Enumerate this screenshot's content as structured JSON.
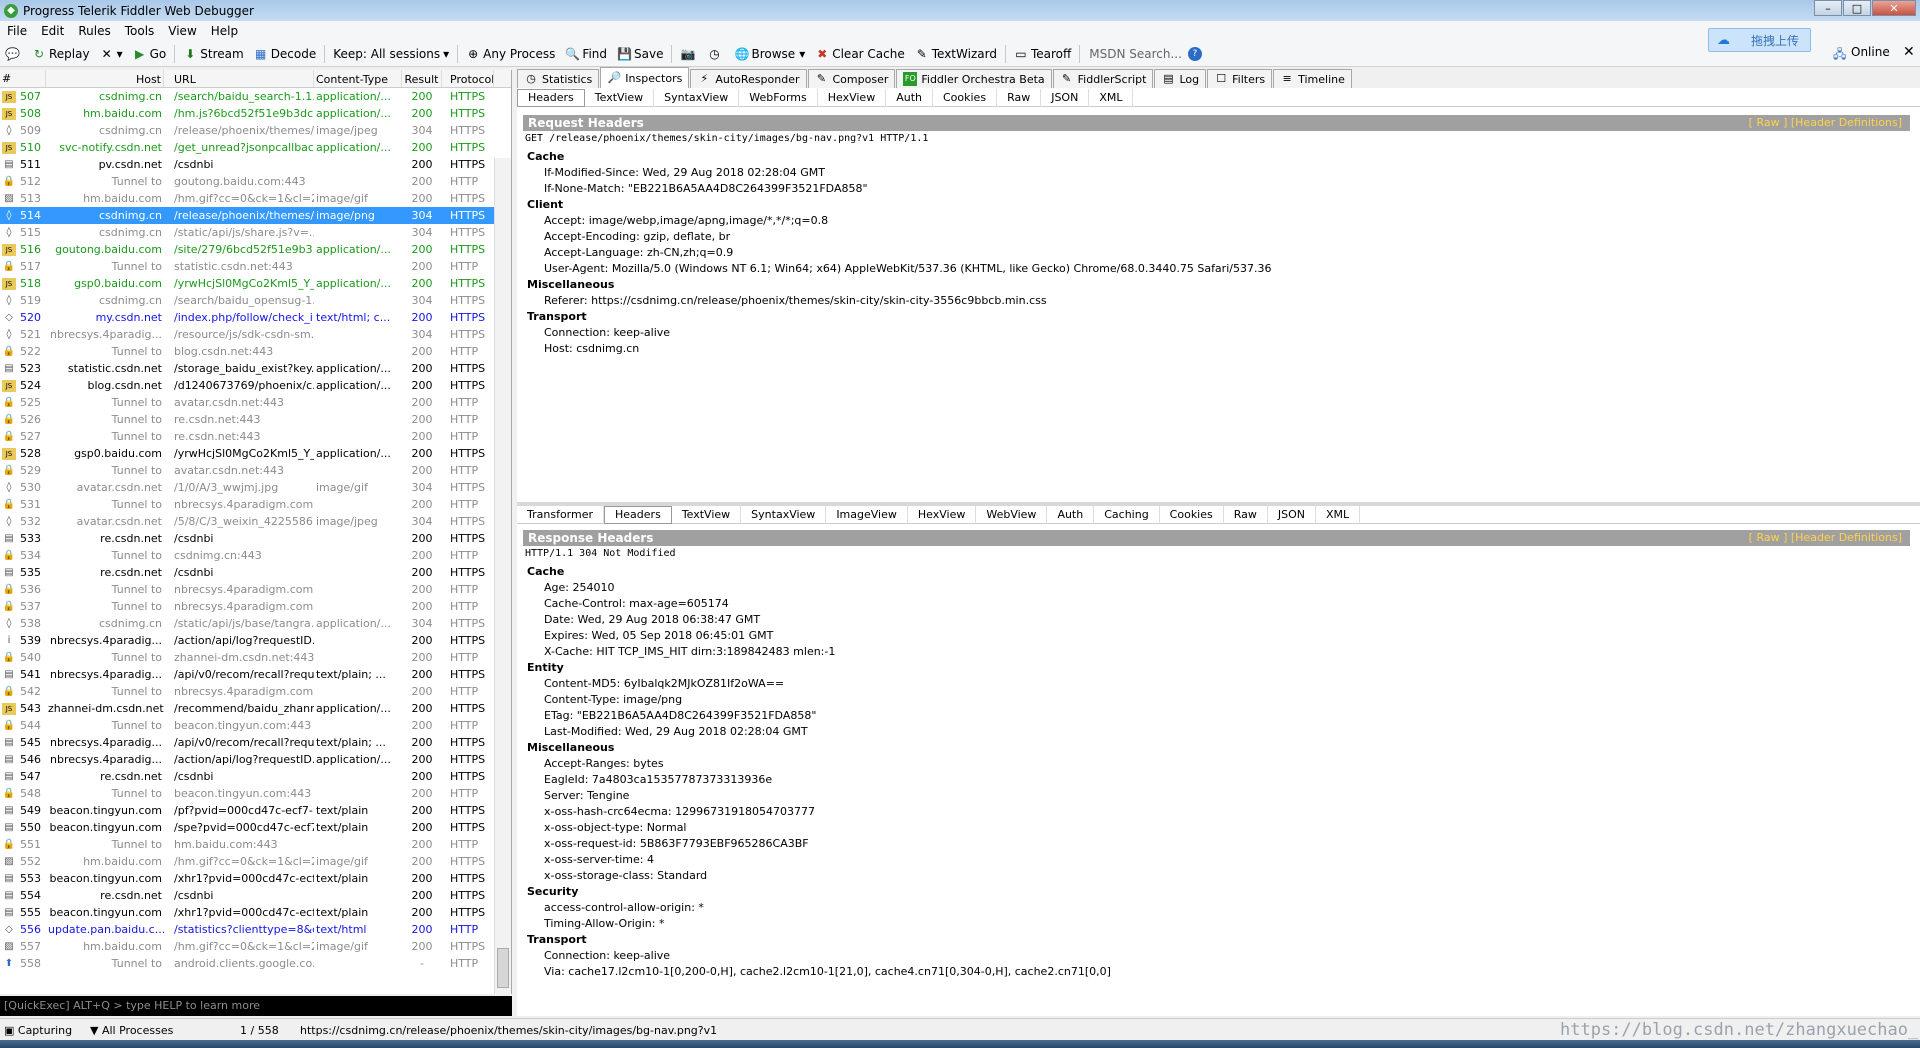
{
  "window": {
    "title": "Progress Telerik Fiddler Web Debugger",
    "icon": "fiddler-icon"
  },
  "menu": [
    "File",
    "Edit",
    "Rules",
    "Tools",
    "View",
    "Help"
  ],
  "toolbar": {
    "replay": "Replay",
    "go": "Go",
    "stream": "Stream",
    "decode": "Decode",
    "keep": "Keep: All sessions",
    "any_process": "Any Process",
    "find": "Find",
    "save": "Save",
    "browse": "Browse",
    "clear_cache": "Clear Cache",
    "textwizard": "TextWizard",
    "tearoff": "Tearoff",
    "msdn_search": "MSDN Search...",
    "online": "Online",
    "upload": "拖拽上传"
  },
  "sessions": {
    "columns": [
      "#",
      "Host",
      "URL",
      "Content-Type",
      "Result",
      "Protocol"
    ],
    "rows": [
      {
        "id": "507",
        "host": "csdnimg.cn",
        "url": "/search/baidu_search-1.1...",
        "ct": "application/...",
        "result": "200",
        "proto": "HTTPS",
        "color": "green",
        "icon": "js-icon"
      },
      {
        "id": "508",
        "host": "hm.baidu.com",
        "url": "/hm.js?6bcd52f51e9b3dc...",
        "ct": "application/...",
        "result": "200",
        "proto": "HTTPS",
        "color": "green",
        "icon": "js-icon"
      },
      {
        "id": "509",
        "host": "csdnimg.cn",
        "url": "/release/phoenix/themes/...",
        "ct": "image/jpeg",
        "result": "304",
        "proto": "HTTPS",
        "color": "grey",
        "icon": "not-modified-icon"
      },
      {
        "id": "510",
        "host": "svc-notify.csdn.net",
        "url": "/get_unread?jsonpcallbac...",
        "ct": "application/...",
        "result": "200",
        "proto": "HTTPS",
        "color": "green",
        "icon": "js-icon"
      },
      {
        "id": "511",
        "host": "pv.csdn.net",
        "url": "/csdnbi",
        "ct": "",
        "result": "200",
        "proto": "HTTPS",
        "color": "black",
        "icon": "doc-icon"
      },
      {
        "id": "512",
        "host": "Tunnel to",
        "url": "goutong.baidu.com:443",
        "ct": "",
        "result": "200",
        "proto": "HTTP",
        "color": "grey",
        "icon": "lock-icon"
      },
      {
        "id": "513",
        "host": "hm.baidu.com",
        "url": "/hm.gif?cc=0&ck=1&cl=2...",
        "ct": "image/gif",
        "result": "200",
        "proto": "HTTPS",
        "color": "grey",
        "icon": "image-icon"
      },
      {
        "id": "514",
        "host": "csdnimg.cn",
        "url": "/release/phoenix/themes/...",
        "ct": "image/png",
        "result": "304",
        "proto": "HTTPS",
        "color": "selected",
        "icon": "not-modified-icon"
      },
      {
        "id": "515",
        "host": "csdnimg.cn",
        "url": "/static/api/js/share.js?v=...",
        "ct": "",
        "result": "304",
        "proto": "HTTPS",
        "color": "grey",
        "icon": "not-modified-icon"
      },
      {
        "id": "516",
        "host": "goutong.baidu.com",
        "url": "/site/279/6bcd52f51e9b3...",
        "ct": "application/...",
        "result": "200",
        "proto": "HTTPS",
        "color": "green",
        "icon": "js-icon"
      },
      {
        "id": "517",
        "host": "Tunnel to",
        "url": "statistic.csdn.net:443",
        "ct": "",
        "result": "200",
        "proto": "HTTP",
        "color": "grey",
        "icon": "lock-icon"
      },
      {
        "id": "518",
        "host": "gsp0.baidu.com",
        "url": "/yrwHcjSl0MgCo2Kml5_Y_...",
        "ct": "application/...",
        "result": "200",
        "proto": "HTTPS",
        "color": "green",
        "icon": "js-icon"
      },
      {
        "id": "519",
        "host": "csdnimg.cn",
        "url": "/search/baidu_opensug-1...",
        "ct": "",
        "result": "304",
        "proto": "HTTPS",
        "color": "grey",
        "icon": "not-modified-icon"
      },
      {
        "id": "520",
        "host": "my.csdn.net",
        "url": "/index.php/follow/check_i...",
        "ct": "text/html; c...",
        "result": "200",
        "proto": "HTTPS",
        "color": "blue",
        "icon": "html-icon"
      },
      {
        "id": "521",
        "host": "nbrecsys.4paradig...",
        "url": "/resource/js/sdk-csdn-sm...",
        "ct": "",
        "result": "304",
        "proto": "HTTPS",
        "color": "grey",
        "icon": "not-modified-icon"
      },
      {
        "id": "522",
        "host": "Tunnel to",
        "url": "blog.csdn.net:443",
        "ct": "",
        "result": "200",
        "proto": "HTTP",
        "color": "grey",
        "icon": "lock-icon"
      },
      {
        "id": "523",
        "host": "statistic.csdn.net",
        "url": "/storage_baidu_exist?key...",
        "ct": "application/...",
        "result": "200",
        "proto": "HTTPS",
        "color": "black",
        "icon": "doc-icon"
      },
      {
        "id": "524",
        "host": "blog.csdn.net",
        "url": "/d1240673769/phoenix/c...",
        "ct": "application/...",
        "result": "200",
        "proto": "HTTPS",
        "color": "black",
        "icon": "js-icon"
      },
      {
        "id": "525",
        "host": "Tunnel to",
        "url": "avatar.csdn.net:443",
        "ct": "",
        "result": "200",
        "proto": "HTTP",
        "color": "grey",
        "icon": "lock-icon"
      },
      {
        "id": "526",
        "host": "Tunnel to",
        "url": "re.csdn.net:443",
        "ct": "",
        "result": "200",
        "proto": "HTTP",
        "color": "grey",
        "icon": "lock-icon"
      },
      {
        "id": "527",
        "host": "Tunnel to",
        "url": "re.csdn.net:443",
        "ct": "",
        "result": "200",
        "proto": "HTTP",
        "color": "grey",
        "icon": "lock-icon"
      },
      {
        "id": "528",
        "host": "gsp0.baidu.com",
        "url": "/yrwHcjSl0MgCo2Kml5_Y_...",
        "ct": "application/...",
        "result": "200",
        "proto": "HTTPS",
        "color": "black",
        "icon": "js-icon"
      },
      {
        "id": "529",
        "host": "Tunnel to",
        "url": "avatar.csdn.net:443",
        "ct": "",
        "result": "200",
        "proto": "HTTP",
        "color": "grey",
        "icon": "lock-icon"
      },
      {
        "id": "530",
        "host": "avatar.csdn.net",
        "url": "/1/0/A/3_wwjmj.jpg",
        "ct": "image/gif",
        "result": "304",
        "proto": "HTTPS",
        "color": "grey",
        "icon": "not-modified-icon"
      },
      {
        "id": "531",
        "host": "Tunnel to",
        "url": "nbrecsys.4paradigm.com:...",
        "ct": "",
        "result": "200",
        "proto": "HTTP",
        "color": "grey",
        "icon": "lock-icon"
      },
      {
        "id": "532",
        "host": "avatar.csdn.net",
        "url": "/5/8/C/3_weixin_4225586...",
        "ct": "image/jpeg",
        "result": "304",
        "proto": "HTTPS",
        "color": "grey",
        "icon": "not-modified-icon"
      },
      {
        "id": "533",
        "host": "re.csdn.net",
        "url": "/csdnbi",
        "ct": "",
        "result": "200",
        "proto": "HTTPS",
        "color": "black",
        "icon": "doc-icon"
      },
      {
        "id": "534",
        "host": "Tunnel to",
        "url": "csdnimg.cn:443",
        "ct": "",
        "result": "200",
        "proto": "HTTP",
        "color": "grey",
        "icon": "lock-icon"
      },
      {
        "id": "535",
        "host": "re.csdn.net",
        "url": "/csdnbi",
        "ct": "",
        "result": "200",
        "proto": "HTTPS",
        "color": "black",
        "icon": "doc-icon"
      },
      {
        "id": "536",
        "host": "Tunnel to",
        "url": "nbrecsys.4paradigm.com:...",
        "ct": "",
        "result": "200",
        "proto": "HTTP",
        "color": "grey",
        "icon": "lock-icon"
      },
      {
        "id": "537",
        "host": "Tunnel to",
        "url": "nbrecsys.4paradigm.com:...",
        "ct": "",
        "result": "200",
        "proto": "HTTP",
        "color": "grey",
        "icon": "lock-icon"
      },
      {
        "id": "538",
        "host": "csdnimg.cn",
        "url": "/static/api/js/base/tangra...",
        "ct": "application/...",
        "result": "304",
        "proto": "HTTPS",
        "color": "grey",
        "icon": "not-modified-icon"
      },
      {
        "id": "539",
        "host": "nbrecsys.4paradig...",
        "url": "/action/api/log?requestID...",
        "ct": "",
        "result": "200",
        "proto": "HTTPS",
        "color": "black",
        "icon": "info-icon"
      },
      {
        "id": "540",
        "host": "Tunnel to",
        "url": "zhannei-dm.csdn.net:443",
        "ct": "",
        "result": "200",
        "proto": "HTTP",
        "color": "grey",
        "icon": "lock-icon"
      },
      {
        "id": "541",
        "host": "nbrecsys.4paradig...",
        "url": "/api/v0/recom/recall?requ...",
        "ct": "text/plain; ...",
        "result": "200",
        "proto": "HTTPS",
        "color": "black",
        "icon": "doc-icon"
      },
      {
        "id": "542",
        "host": "Tunnel to",
        "url": "nbrecsys.4paradigm.com:...",
        "ct": "",
        "result": "200",
        "proto": "HTTP",
        "color": "grey",
        "icon": "lock-icon"
      },
      {
        "id": "543",
        "host": "zhannei-dm.csdn.net",
        "url": "/recommend/baidu_zhann...",
        "ct": "application/...",
        "result": "200",
        "proto": "HTTPS",
        "color": "black",
        "icon": "js-icon"
      },
      {
        "id": "544",
        "host": "Tunnel to",
        "url": "beacon.tingyun.com:443",
        "ct": "",
        "result": "200",
        "proto": "HTTP",
        "color": "grey",
        "icon": "lock-icon"
      },
      {
        "id": "545",
        "host": "nbrecsys.4paradig...",
        "url": "/api/v0/recom/recall?requ...",
        "ct": "text/plain; ...",
        "result": "200",
        "proto": "HTTPS",
        "color": "black",
        "icon": "doc-icon"
      },
      {
        "id": "546",
        "host": "nbrecsys.4paradig...",
        "url": "/action/api/log?requestID...",
        "ct": "application/...",
        "result": "200",
        "proto": "HTTPS",
        "color": "black",
        "icon": "doc-icon"
      },
      {
        "id": "547",
        "host": "re.csdn.net",
        "url": "/csdnbi",
        "ct": "",
        "result": "200",
        "proto": "HTTPS",
        "color": "black",
        "icon": "doc-icon"
      },
      {
        "id": "548",
        "host": "Tunnel to",
        "url": "beacon.tingyun.com:443",
        "ct": "",
        "result": "200",
        "proto": "HTTP",
        "color": "grey",
        "icon": "lock-icon"
      },
      {
        "id": "549",
        "host": "beacon.tingyun.com",
        "url": "/pf?pvid=000cd47c-ecf7-...",
        "ct": "text/plain",
        "result": "200",
        "proto": "HTTPS",
        "color": "black",
        "icon": "doc-icon"
      },
      {
        "id": "550",
        "host": "beacon.tingyun.com",
        "url": "/spe?pvid=000cd47c-ecf7...",
        "ct": "text/plain",
        "result": "200",
        "proto": "HTTPS",
        "color": "black",
        "icon": "doc-icon"
      },
      {
        "id": "551",
        "host": "Tunnel to",
        "url": "hm.baidu.com:443",
        "ct": "",
        "result": "200",
        "proto": "HTTP",
        "color": "grey",
        "icon": "lock-icon"
      },
      {
        "id": "552",
        "host": "hm.baidu.com",
        "url": "/hm.gif?cc=0&ck=1&cl=2...",
        "ct": "image/gif",
        "result": "200",
        "proto": "HTTPS",
        "color": "grey",
        "icon": "image-icon"
      },
      {
        "id": "553",
        "host": "beacon.tingyun.com",
        "url": "/xhr1?pvid=000cd47c-ecf...",
        "ct": "text/plain",
        "result": "200",
        "proto": "HTTPS",
        "color": "black",
        "icon": "doc-icon"
      },
      {
        "id": "554",
        "host": "re.csdn.net",
        "url": "/csdnbi",
        "ct": "",
        "result": "200",
        "proto": "HTTPS",
        "color": "black",
        "icon": "doc-icon"
      },
      {
        "id": "555",
        "host": "beacon.tingyun.com",
        "url": "/xhr1?pvid=000cd47c-ecf...",
        "ct": "text/plain",
        "result": "200",
        "proto": "HTTPS",
        "color": "black",
        "icon": "doc-icon"
      },
      {
        "id": "556",
        "host": "update.pan.baidu.c...",
        "url": "/statistics?clienttype=8&d...",
        "ct": "text/html",
        "result": "200",
        "proto": "HTTP",
        "color": "blue",
        "icon": "html-icon"
      },
      {
        "id": "557",
        "host": "hm.baidu.com",
        "url": "/hm.gif?cc=0&ck=1&cl=2...",
        "ct": "image/gif",
        "result": "200",
        "proto": "HTTPS",
        "color": "grey",
        "icon": "image-icon"
      },
      {
        "id": "558",
        "host": "Tunnel to",
        "url": "android.clients.google.co...",
        "ct": "",
        "result": "-",
        "proto": "HTTP",
        "color": "grey",
        "icon": "upload-arrow-icon"
      }
    ]
  },
  "quickexec": "[QuickExec] ALT+Q > type HELP to learn more",
  "status": {
    "capturing": "Capturing",
    "processes": "All Processes",
    "count": "1 / 558",
    "url": "https://csdnimg.cn/release/phoenix/themes/skin-city/images/bg-nav.png?v1"
  },
  "watermark": "https://blog.csdn.net/zhangxuechao_",
  "tabs": [
    "Statistics",
    "Inspectors",
    "AutoResponder",
    "Composer",
    "Fiddler Orchestra Beta",
    "FiddlerScript",
    "Log",
    "Filters",
    "Timeline"
  ],
  "request_tabs": [
    "Headers",
    "TextView",
    "SyntaxView",
    "WebForms",
    "HexView",
    "Auth",
    "Cookies",
    "Raw",
    "JSON",
    "XML"
  ],
  "response_tabs": [
    "Transformer",
    "Headers",
    "TextView",
    "SyntaxView",
    "ImageView",
    "HexView",
    "WebView",
    "Auth",
    "Caching",
    "Cookies",
    "Raw",
    "JSON",
    "XML"
  ],
  "request": {
    "title": "Request Headers",
    "links": "[ Raw ]   [Header Definitions]",
    "line": "GET /release/phoenix/themes/skin-city/images/bg-nav.png?v1 HTTP/1.1",
    "groups": [
      {
        "name": "Cache",
        "items": [
          "If-Modified-Since: Wed, 29 Aug 2018 02:28:04 GMT",
          "If-None-Match: \"EB221B6A5AA4D8C264399F3521FDA858\""
        ]
      },
      {
        "name": "Client",
        "items": [
          "Accept: image/webp,image/apng,image/*,*/*;q=0.8",
          "Accept-Encoding: gzip, deflate, br",
          "Accept-Language: zh-CN,zh;q=0.9",
          "User-Agent: Mozilla/5.0 (Windows NT 6.1; Win64; x64) AppleWebKit/537.36 (KHTML, like Gecko) Chrome/68.0.3440.75 Safari/537.36"
        ]
      },
      {
        "name": "Miscellaneous",
        "items": [
          "Referer: https://csdnimg.cn/release/phoenix/themes/skin-city/skin-city-3556c9bbcb.min.css"
        ]
      },
      {
        "name": "Transport",
        "items": [
          "Connection: keep-alive",
          "Host: csdnimg.cn"
        ]
      }
    ]
  },
  "response": {
    "title": "Response Headers",
    "links": "[ Raw ]   [Header Definitions]",
    "line": "HTTP/1.1 304 Not Modified",
    "groups": [
      {
        "name": "Cache",
        "items": [
          "Age: 254010",
          "Cache-Control: max-age=605174",
          "Date: Wed, 29 Aug 2018 06:38:47 GMT",
          "Expires: Wed, 05 Sep 2018 06:45:01 GMT",
          "X-Cache: HIT TCP_IMS_HIT dirn:3:189842483 mlen:-1"
        ]
      },
      {
        "name": "Entity",
        "items": [
          "Content-MD5: 6yIbalqk2MJkOZ81If2oWA==",
          "Content-Type: image/png",
          "ETag: \"EB221B6A5AA4D8C264399F3521FDA858\"",
          "Last-Modified: Wed, 29 Aug 2018 02:28:04 GMT"
        ]
      },
      {
        "name": "Miscellaneous",
        "items": [
          "Accept-Ranges: bytes",
          "EagleId: 7a4803ca15357787373313936e",
          "Server: Tengine",
          "x-oss-hash-crc64ecma: 12996731918054703777",
          "x-oss-object-type: Normal",
          "x-oss-request-id: 5B863F7793EBF965286CA3BF",
          "x-oss-server-time: 4",
          "x-oss-storage-class: Standard"
        ]
      },
      {
        "name": "Security",
        "items": [
          "access-control-allow-origin: *",
          "Timing-Allow-Origin: *"
        ]
      },
      {
        "name": "Transport",
        "items": [
          "Connection: keep-alive",
          "Via: cache17.l2cm10-1[0,200-0,H], cache2.l2cm10-1[21,0], cache4.cn71[0,304-0,H], cache2.cn71[0,0]"
        ]
      }
    ]
  }
}
